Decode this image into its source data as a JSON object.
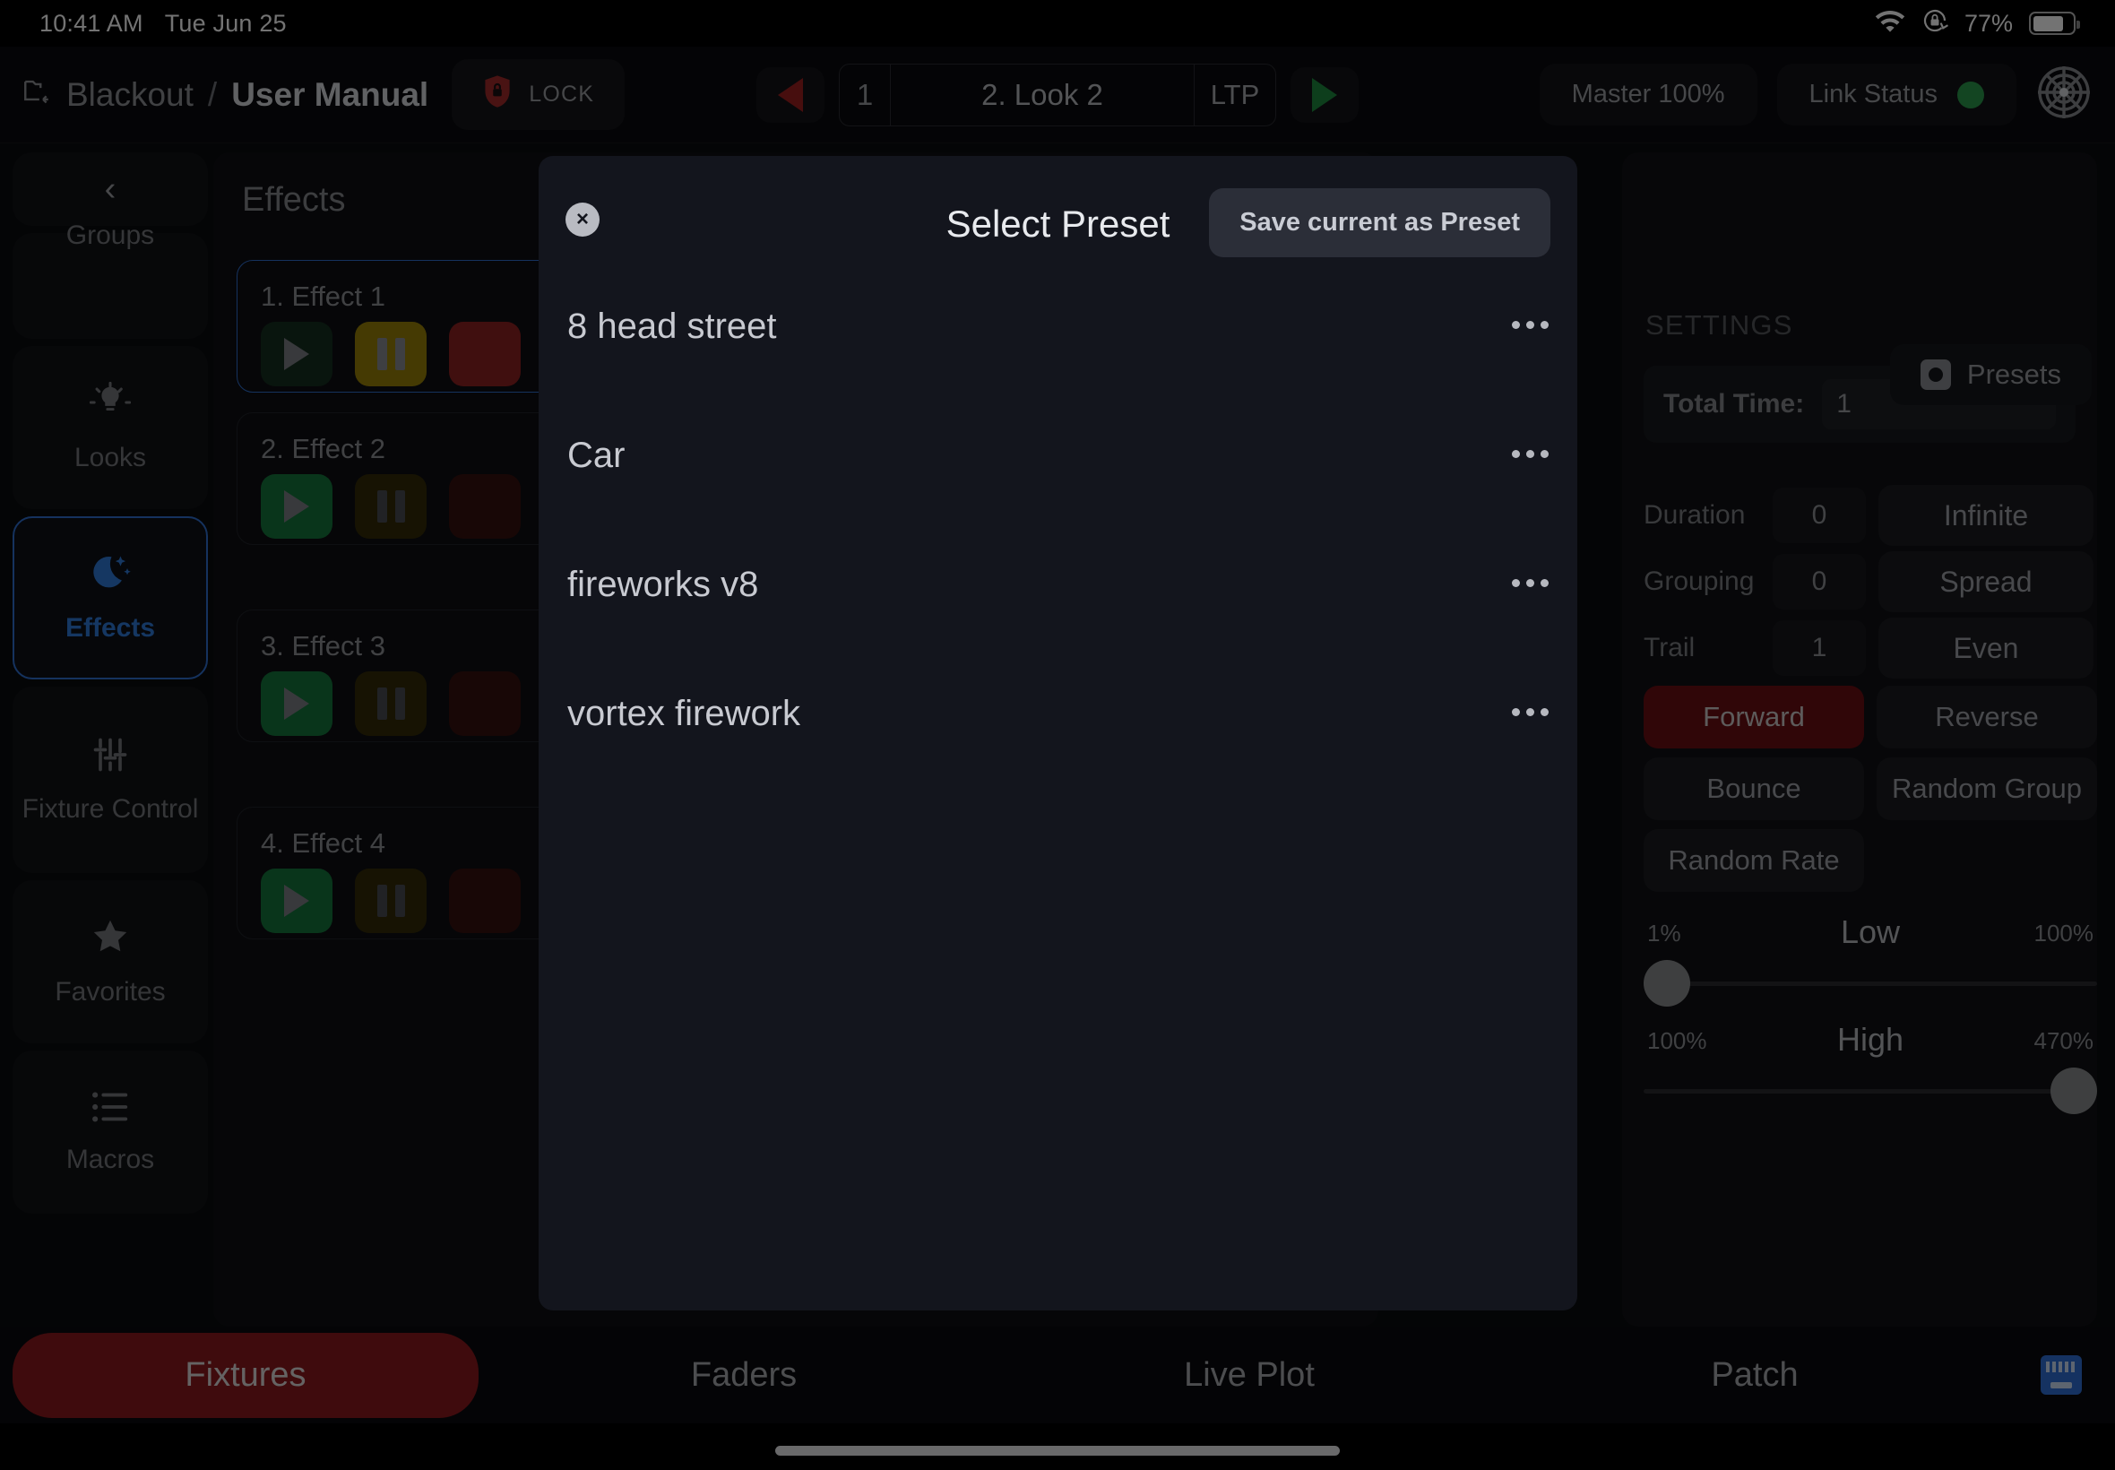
{
  "statusbar": {
    "time": "10:41 AM",
    "date": "Tue Jun 25",
    "wifi_icon": "wifi-icon",
    "rotation_lock_icon": "rotation-lock-icon",
    "battery_percent": "77%",
    "battery_icon": "battery-icon"
  },
  "toolbar": {
    "folder_icon": "folder-open-icon",
    "breadcrumb_root": "Blackout",
    "breadcrumb_sep": "/",
    "breadcrumb_current": "User Manual",
    "lock_icon": "shield-lock-icon",
    "lock_label": "LOCK",
    "prev_icon": "previous-cue-icon",
    "cue_number": "1",
    "cue_name": "2. Look 2",
    "cue_mode": "LTP",
    "next_icon": "next-cue-icon",
    "master_label": "Master 100%",
    "link_status_label": "Link Status",
    "link_status_color": "#2a9a4c",
    "radar_icon": "radar-target-icon"
  },
  "sidebar": {
    "collapse_icon": "chevron-left-icon",
    "items": [
      {
        "label": "Groups",
        "icon": "groups-icon",
        "active": false
      },
      {
        "label": "Looks",
        "icon": "lightbulb-icon",
        "active": false
      },
      {
        "label": "Effects",
        "icon": "moon-stars-icon",
        "active": true
      },
      {
        "label": "Fixture Control",
        "icon": "sliders-icon",
        "active": false
      },
      {
        "label": "Favorites",
        "icon": "star-icon",
        "active": false
      },
      {
        "label": "Macros",
        "icon": "list-icon",
        "active": false
      }
    ]
  },
  "effects": {
    "title": "Effects",
    "presets_button": "Presets",
    "presets_icon": "gear-square-icon",
    "rows": [
      {
        "label": "1. Effect 1",
        "selected": true,
        "play_icon": "play-icon",
        "pause_icon": "pause-icon",
        "stop_icon": "stop-icon"
      },
      {
        "label": "2. Effect 2",
        "selected": false,
        "play_icon": "play-icon",
        "pause_icon": "pause-icon",
        "stop_icon": "stop-icon"
      },
      {
        "label": "3. Effect 3",
        "selected": false,
        "play_icon": "play-icon",
        "pause_icon": "pause-icon",
        "stop_icon": "stop-icon"
      },
      {
        "label": "4. Effect 4",
        "selected": false,
        "play_icon": "play-icon",
        "pause_icon": "pause-icon",
        "stop_icon": "stop-icon"
      }
    ]
  },
  "settings": {
    "heading": "SETTINGS",
    "total_time_label": "Total Time:",
    "total_time_value": "1",
    "rows": [
      {
        "label": "Duration",
        "value": "0",
        "button": "Infinite"
      },
      {
        "label": "Grouping",
        "value": "0",
        "button": "Spread"
      },
      {
        "label": "Trail",
        "value": "1",
        "button": "Even"
      }
    ],
    "modes": [
      {
        "label": "Forward",
        "active": true
      },
      {
        "label": "Reverse",
        "active": false
      },
      {
        "label": "Bounce",
        "active": false
      },
      {
        "label": "Random Group",
        "active": false
      },
      {
        "label": "Random Rate",
        "active": false
      }
    ],
    "active_mode_color": "#6a0f12",
    "sliders": [
      {
        "name": "Low",
        "min": "1%",
        "max": "100%",
        "value_pct": 0
      },
      {
        "name": "High",
        "min": "100%",
        "max": "470%",
        "value_pct": 100
      }
    ]
  },
  "modal": {
    "close_icon": "close-icon",
    "title": "Select Preset",
    "save_button": "Save current as Preset",
    "presets": [
      {
        "name": "8 head street",
        "more_icon": "more-options-icon"
      },
      {
        "name": "Car",
        "more_icon": "more-options-icon"
      },
      {
        "name": "fireworks v8",
        "more_icon": "more-options-icon"
      },
      {
        "name": "vortex firework",
        "more_icon": "more-options-icon"
      }
    ]
  },
  "tabbar": {
    "tabs": [
      {
        "label": "Fixtures",
        "active": true
      },
      {
        "label": "Faders",
        "active": false
      },
      {
        "label": "Live Plot",
        "active": false
      },
      {
        "label": "Patch",
        "active": false
      }
    ],
    "keyboard_icon": "keyboard-icon",
    "active_color": "#8d1a1d"
  }
}
